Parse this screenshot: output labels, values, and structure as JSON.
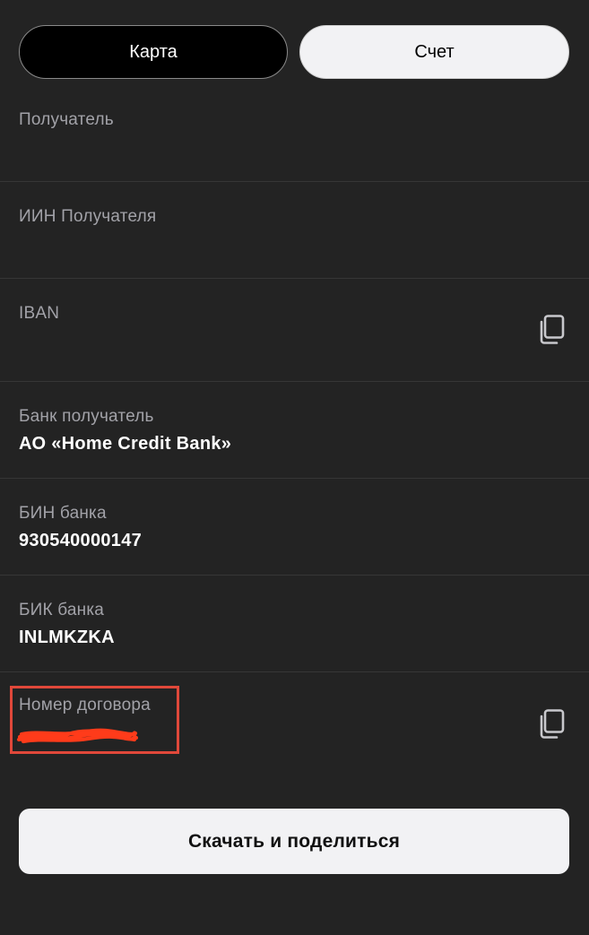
{
  "tabs": {
    "card_label": "Карта",
    "account_label": "Счет"
  },
  "fields": {
    "recipient": {
      "label": "Получатель",
      "value": ""
    },
    "recipient_iin": {
      "label": "ИИН Получателя",
      "value": ""
    },
    "iban": {
      "label": "IBAN",
      "value": ""
    },
    "bank_name": {
      "label": "Банк получатель",
      "value": "АО «Home Credit Bank»"
    },
    "bank_bin": {
      "label": "БИН банка",
      "value": "930540000147"
    },
    "bank_bik": {
      "label": "БИК банка",
      "value": "INLMKZKA"
    },
    "contract_number": {
      "label": "Номер договора",
      "value": ""
    }
  },
  "actions": {
    "download_share_label": "Скачать и поделиться"
  },
  "icons": {
    "copy": "copy-icon"
  },
  "colors": {
    "background": "#232323",
    "highlight_border": "#e0483a",
    "redaction_scribble": "#ff3b1a"
  }
}
